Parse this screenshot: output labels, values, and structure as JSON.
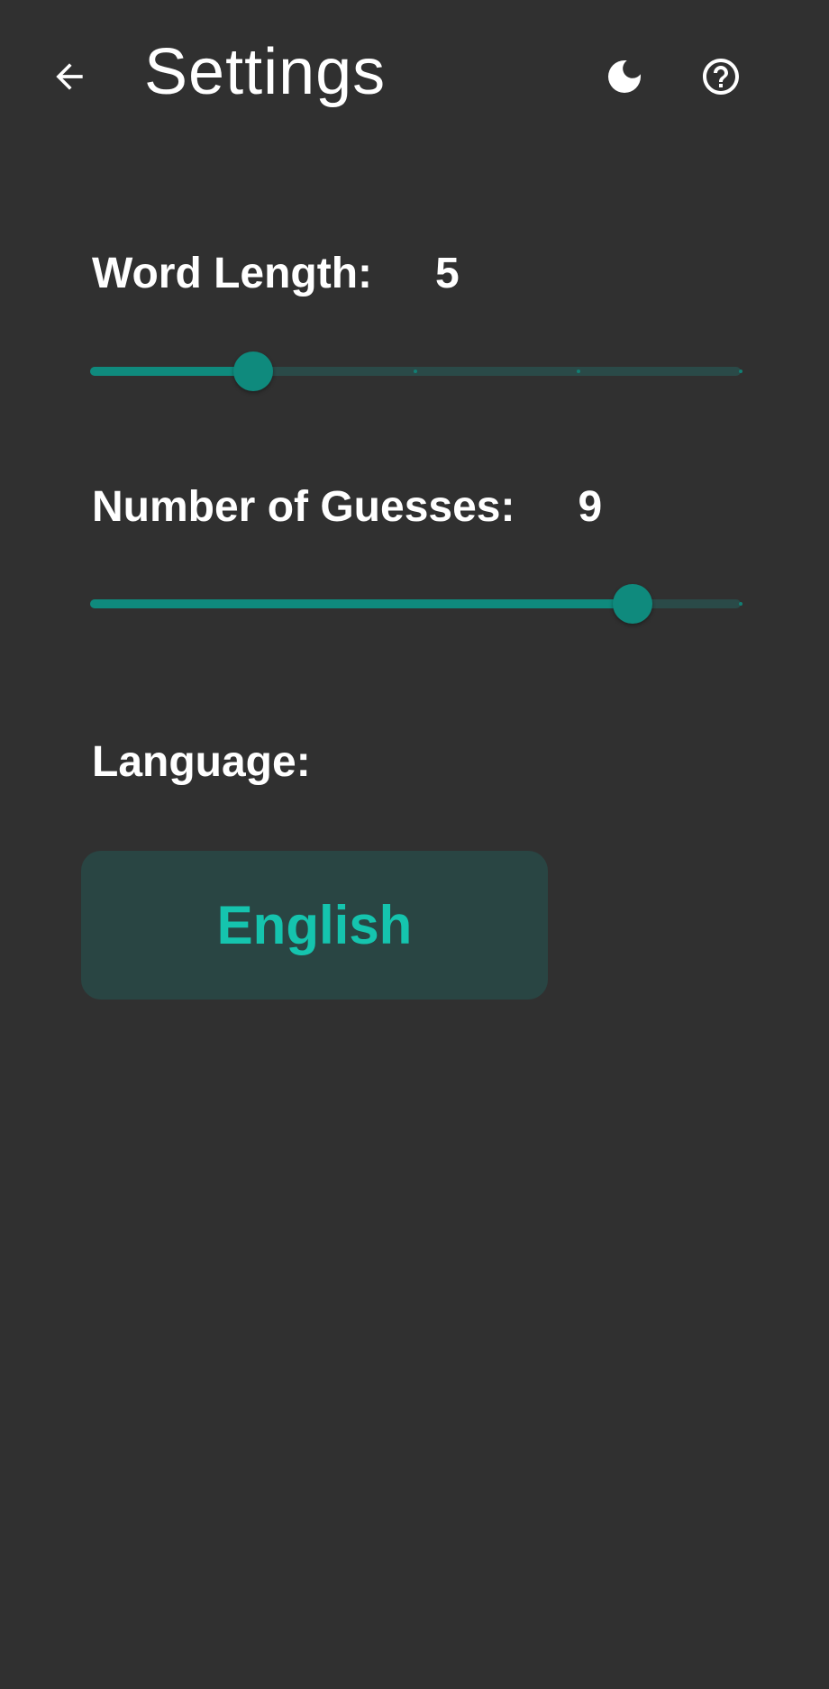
{
  "header": {
    "title": "Settings",
    "back_icon": "arrow-left-icon",
    "theme_icon": "moon-icon",
    "help_icon": "help-circle-icon"
  },
  "settings": {
    "word_length": {
      "label": "Word Length:",
      "value": "5",
      "min": 4,
      "max": 8,
      "current": 5,
      "step": 1
    },
    "guesses": {
      "label": "Number of Guesses:",
      "value": "9",
      "min": 4,
      "max": 10,
      "current": 9,
      "step": 1
    },
    "language": {
      "label": "Language:",
      "selected": "English"
    }
  },
  "colors": {
    "background": "#303030",
    "accent": "#0f8a7d",
    "accent_text": "#15c4ae",
    "track_inactive": "#2a4a48",
    "button_bg": "#294543"
  }
}
